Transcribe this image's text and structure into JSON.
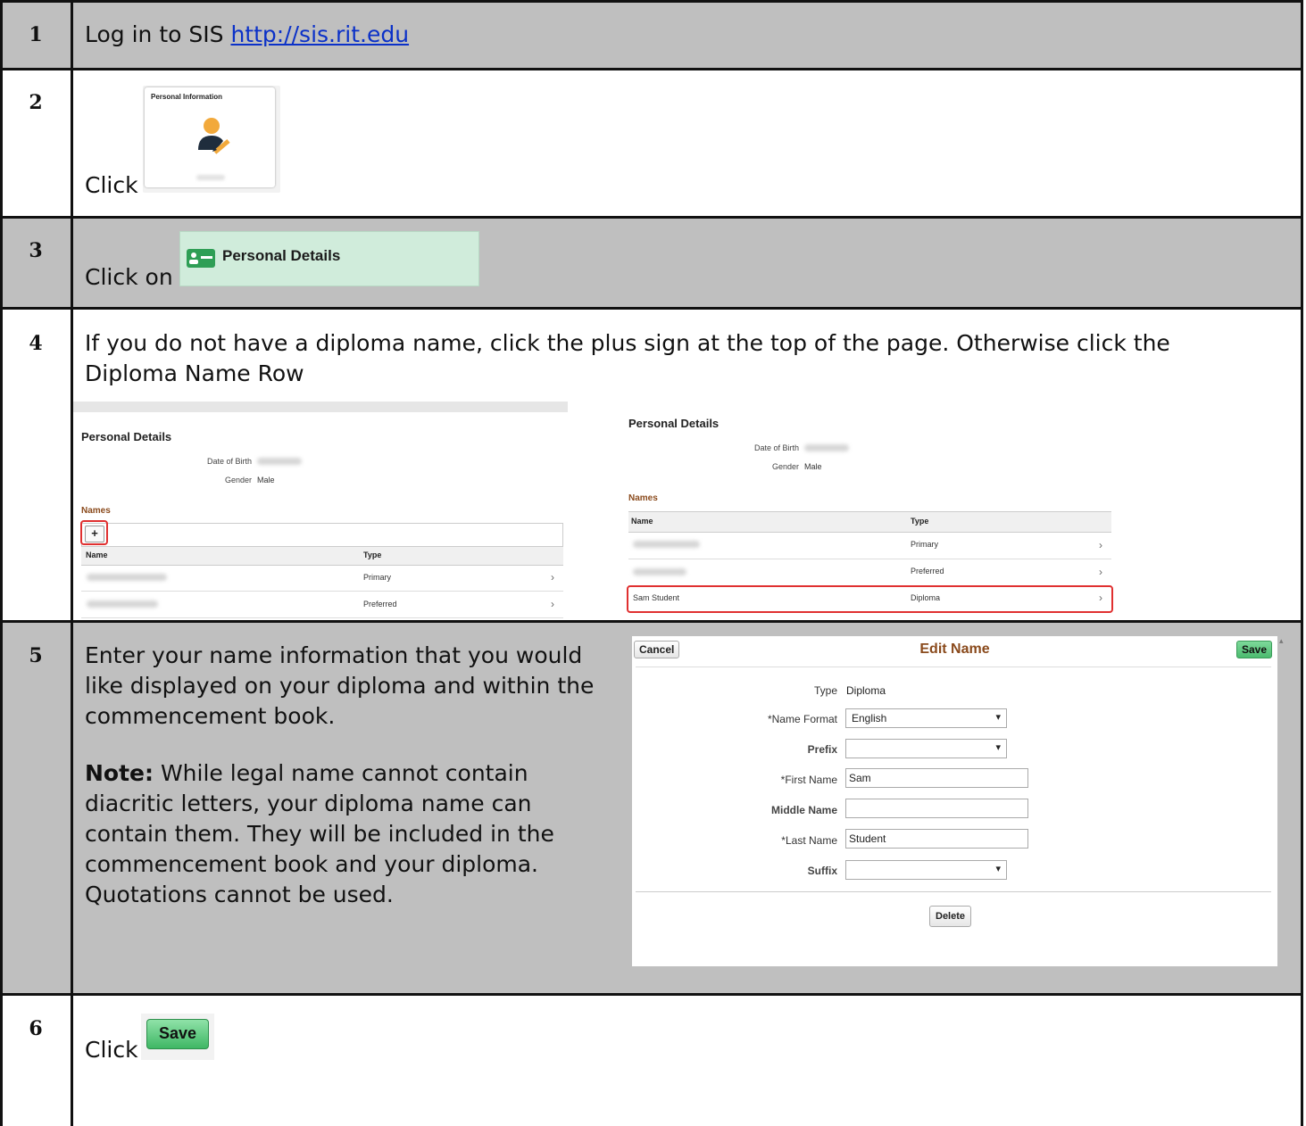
{
  "steps": [
    {
      "num": "1",
      "text_before": "Log in to SIS ",
      "link": "http://sis.rit.edu"
    },
    {
      "num": "2",
      "text": "Click",
      "tile_title": "Personal Information"
    },
    {
      "num": "3",
      "text": "Click on",
      "button_label": "Personal Details"
    },
    {
      "num": "4",
      "text": "If you do not have a diploma name, click the plus sign at the top of the page. Otherwise click the Diploma Name Row"
    },
    {
      "num": "5",
      "paragraph1": "Enter your name information that you would like displayed on your diploma and within the commencement book.",
      "note_label": "Note:",
      "note_text": " While legal name cannot contain diacritic letters, your diploma name can contain them. They will be included in the commencement book and your diploma. Quotations cannot be used."
    },
    {
      "num": "6",
      "text": "Click",
      "button_label": "Save"
    }
  ],
  "shot_left": {
    "heading": "Personal Details",
    "dob_label": "Date of Birth",
    "gender_label": "Gender",
    "gender_value": "Male",
    "names_label": "Names",
    "plus": "+",
    "col_name": "Name",
    "col_type": "Type",
    "rows": [
      {
        "type": "Primary"
      },
      {
        "type": "Preferred"
      }
    ]
  },
  "shot_right": {
    "heading": "Personal Details",
    "dob_label": "Date of Birth",
    "gender_label": "Gender",
    "gender_value": "Male",
    "names_label": "Names",
    "col_name": "Name",
    "col_type": "Type",
    "rows": [
      {
        "name": "",
        "type": "Primary"
      },
      {
        "name": "",
        "type": "Preferred"
      },
      {
        "name": "Sam Student",
        "type": "Diploma"
      }
    ]
  },
  "edit_name": {
    "cancel": "Cancel",
    "title": "Edit Name",
    "save": "Save",
    "type_label": "Type",
    "type_value": "Diploma",
    "name_format_label": "*Name Format",
    "name_format_value": "English",
    "prefix_label": "Prefix",
    "prefix_value": "",
    "first_name_label": "*First Name",
    "first_name_value": "Sam",
    "middle_name_label": "Middle Name",
    "middle_name_value": "",
    "last_name_label": "*Last Name",
    "last_name_value": "Student",
    "suffix_label": "Suffix",
    "suffix_value": "",
    "delete": "Delete"
  },
  "colors": {
    "row_gray": "#bfbfbf",
    "link": "#0b31c8",
    "names_brown": "#8a4a1c",
    "highlight_red": "#e03030",
    "save_green": "#4cbb6f"
  }
}
